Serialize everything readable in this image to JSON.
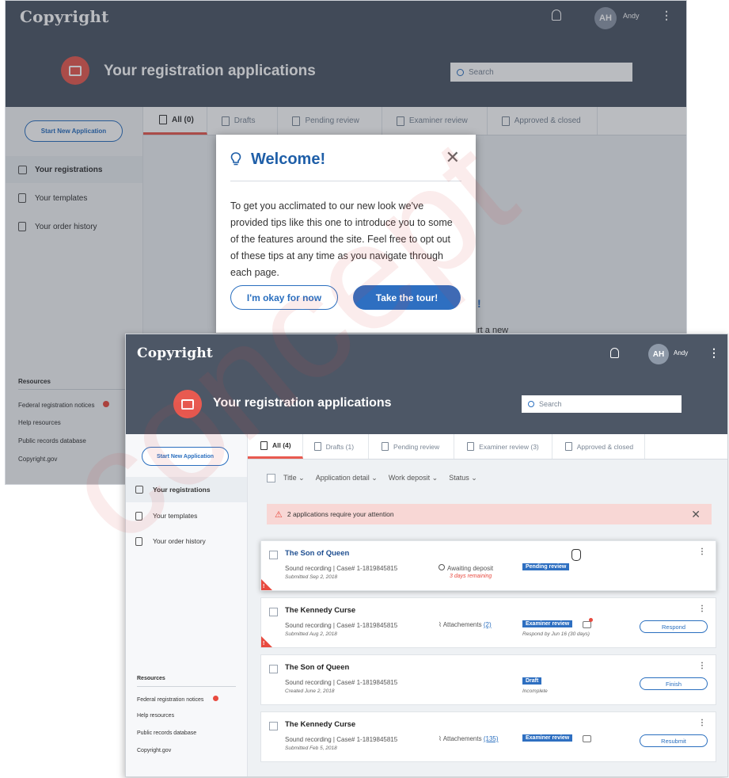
{
  "brand": {
    "logo": "Copyright",
    "accent": "#e85a50",
    "header_bg": "#4d5766",
    "primary": "#2e6fc1"
  },
  "back": {
    "user": {
      "initials": "AH",
      "name": "Andy"
    },
    "hero_title": "Your registration applications",
    "search_placeholder": "Search",
    "start_button": "Start New Application",
    "nav": [
      "Your registrations",
      "Your templates",
      "Your order history"
    ],
    "tabs": [
      "All (0)",
      "Drafts",
      "Pending review",
      "Examiner review",
      "Approved & closed"
    ],
    "resources": {
      "title": "Resources",
      "links": [
        "Federal registration notices",
        "Help resources",
        "Public records database",
        "Copyright.gov"
      ]
    },
    "peek_text": [
      "!",
      "rt a new"
    ]
  },
  "modal": {
    "title": "Welcome!",
    "body": "To get you acclimated to our new look we've provided tips like this one to introduce you to some of the features around the site. Feel free to opt out of these tips at any time as you navigate through each page.",
    "ok_button": "I'm okay for now",
    "tour_button": "Take the tour!"
  },
  "front": {
    "user": {
      "initials": "AH",
      "name": "Andy"
    },
    "hero_title": "Your registration applications",
    "search_placeholder": "Search",
    "start_button": "Start New Application",
    "nav": [
      "Your registrations",
      "Your templates",
      "Your order history"
    ],
    "tabs": [
      "All (4)",
      "Drafts (1)",
      "Pending review",
      "Examiner review (3)",
      "Approved & closed"
    ],
    "filters": [
      "Title",
      "Application detail",
      "Work deposit",
      "Status"
    ],
    "alert": "2 applications require your attention",
    "resources": {
      "title": "Resources",
      "links": [
        "Federal registration notices",
        "Help resources",
        "Public records database",
        "Copyright.gov"
      ]
    },
    "cards": [
      {
        "title": "The Son of Queen",
        "sub": "Sound recording | Case# 1-1819845815",
        "date": "Submitted Sep 2, 2018",
        "mid": "Awaiting deposit",
        "remaining": "3 days remaining",
        "status": "Pending review"
      },
      {
        "title": "The Kennedy Curse",
        "sub": "Sound recording | Case# 1-1819845815",
        "date": "Submitted Aug 2, 2018",
        "mid_label": "Attachements",
        "mid_count": "(2)",
        "status": "Examiner review",
        "note": "Respond by Jun 16 (30 days)",
        "action": "Respond"
      },
      {
        "title": "The Son of Queen",
        "sub": "Sound recording | Case# 1-1819845815",
        "date": "Created June 2, 2018",
        "status": "Draft",
        "note": "Incomplete",
        "action": "Finish"
      },
      {
        "title": "The Kennedy Curse",
        "sub": "Sound recording | Case# 1-1819845815",
        "date": "Submitted Feb 5, 2018",
        "mid_label": "Attachements",
        "mid_count": "(135)",
        "status": "Examiner review",
        "action": "Resubmit"
      }
    ]
  },
  "watermark": "concept"
}
